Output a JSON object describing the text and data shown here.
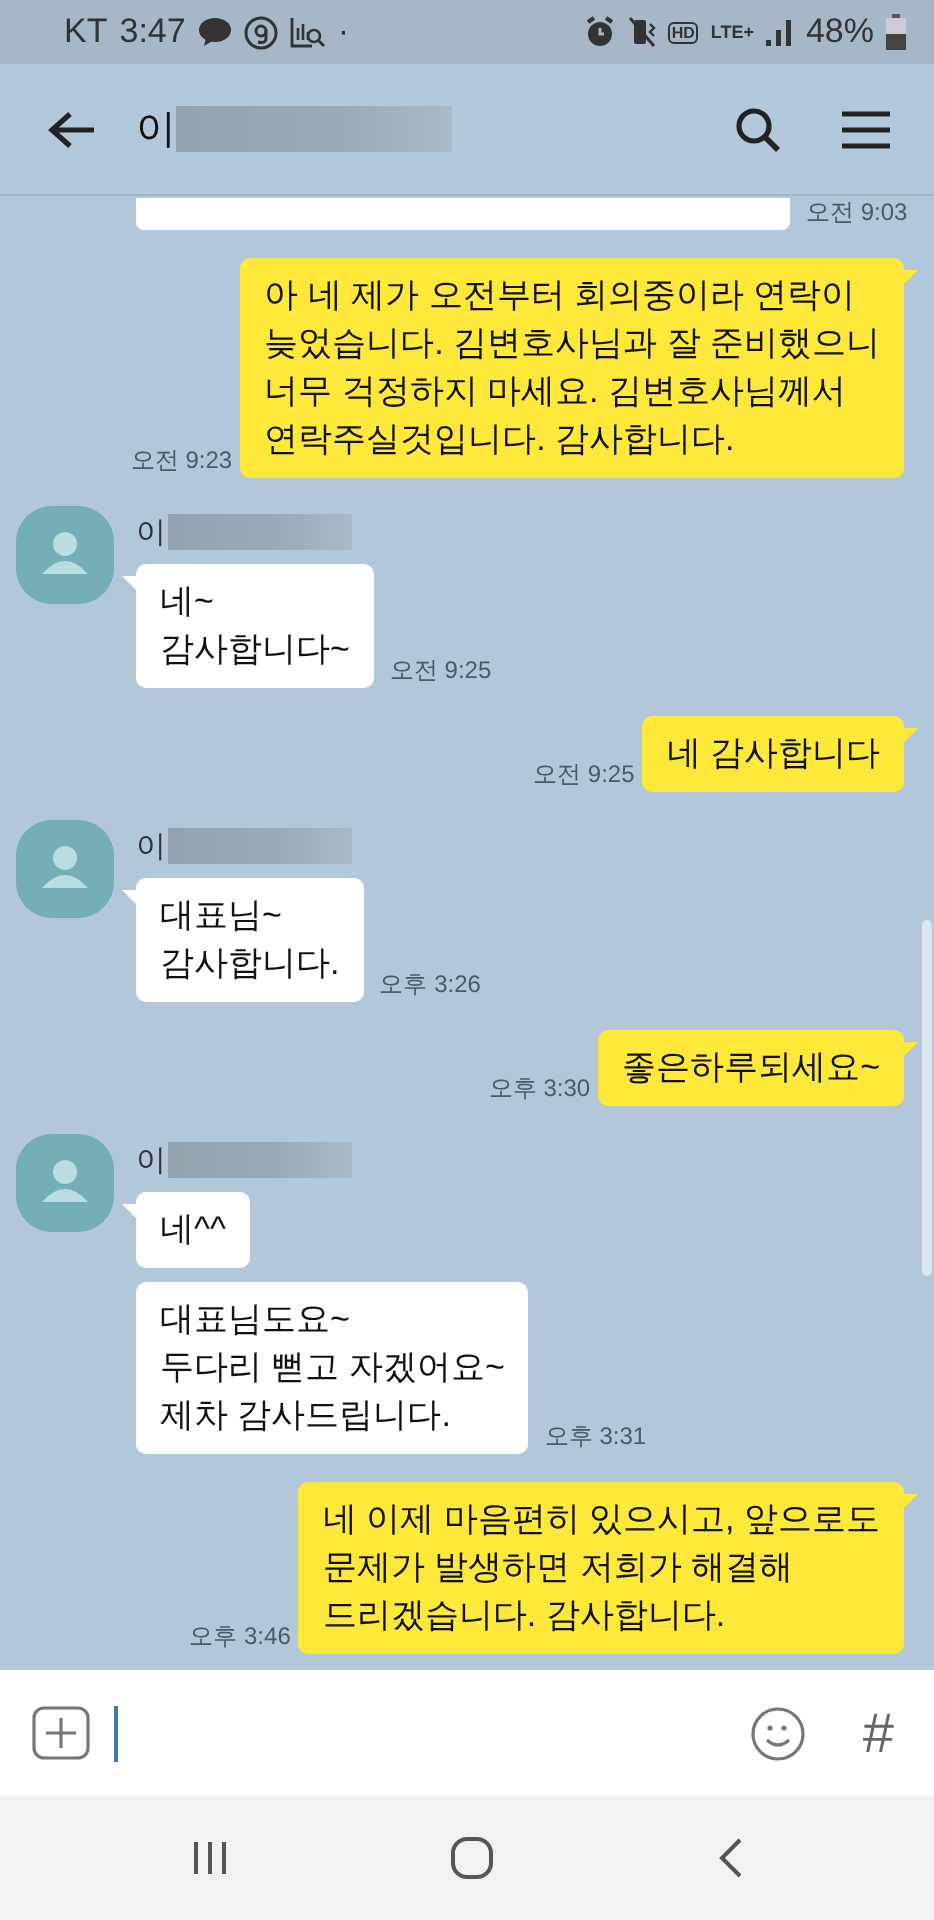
{
  "status_bar": {
    "carrier": "KT",
    "time": "3:47",
    "dot": "·",
    "hd": "HD",
    "network": "LTE+",
    "battery": "48%"
  },
  "header": {
    "title": "이"
  },
  "messages": [
    {
      "kind": "cut",
      "time": "오전 9:03"
    },
    {
      "kind": "sent",
      "text": "아 네 제가 오전부터 회의중이라 연락이\n늦었습니다. 김변호사님과 잘 준비했으니\n너무 걱정하지 마세요. 김변호사님께서\n연락주실것입니다. 감사합니다.",
      "time": "오전 9:23"
    },
    {
      "kind": "received",
      "sender": "이",
      "bubbles": [
        "네~\n감사합니다~"
      ],
      "time": "오전 9:25"
    },
    {
      "kind": "sent",
      "text": "네 감사합니다",
      "time": "오전 9:25"
    },
    {
      "kind": "received",
      "sender": "이",
      "bubbles": [
        "대표님~\n감사합니다."
      ],
      "time": "오후 3:26"
    },
    {
      "kind": "sent",
      "text": "좋은하루되세요~",
      "time": "오후 3:30"
    },
    {
      "kind": "received",
      "sender": "이",
      "bubbles": [
        "네^^",
        "대표님도요~\n두다리 뻗고 자겠어요~\n제차 감사드립니다."
      ],
      "time": "오후 3:31"
    },
    {
      "kind": "sent",
      "text": "네 이제 마음편히 있으시고, 앞으로도\n문제가 발생하면 저희가 해결해\n드리겠습니다. 감사합니다.",
      "time": "오후 3:46"
    }
  ],
  "input_bar": {
    "hashtag": "#"
  }
}
